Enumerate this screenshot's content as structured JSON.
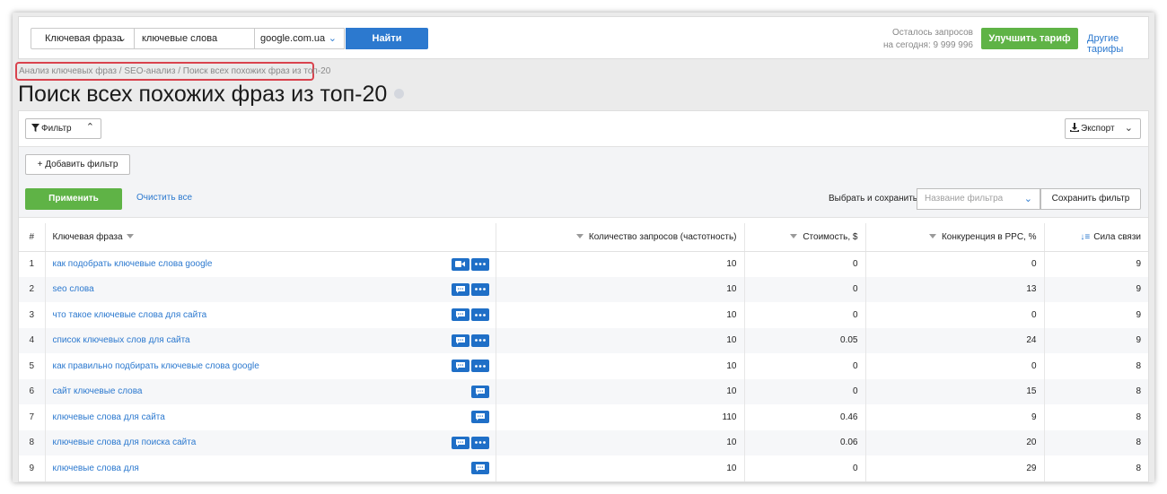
{
  "search": {
    "type_label": "Ключевая фраза",
    "keyword_value": "ключевые слова",
    "domain_value": "google.com.ua",
    "find_label": "Найти"
  },
  "quota": {
    "line1": "Осталось запросов",
    "line2": "на сегодня: 9 999 996"
  },
  "upgrade_label": "Улучшить тариф",
  "tariffs_link": "Другие тарифы",
  "breadcrumb": "Анализ ключевых фраз / SEO-анализ / Поиск всех похожих фраз из топ-20",
  "page_title": "Поиск всех похожих фраз из топ-20",
  "toolbar": {
    "filter_label": "Фильтр",
    "export_label": "Экспорт"
  },
  "filters": {
    "add_label": "+ Добавить фильтр",
    "apply_label": "Применить",
    "clear_label": "Очистить все",
    "save_label": "Выбрать и сохранить",
    "name_placeholder": "Название фильтра",
    "save_button": "Сохранить фильтр"
  },
  "table": {
    "headers": {
      "num": "#",
      "phrase": "Ключевая фраза",
      "volume": "Количество запросов (частотность)",
      "cost": "Стоимость, $",
      "competition": "Конкуренция в PPC, %",
      "strength": "Сила связи"
    },
    "rows": [
      {
        "num": "1",
        "phrase": "как подобрать ключевые слова google",
        "volume": "10",
        "cost": "0",
        "competition": "0",
        "strength": "9",
        "icons": [
          "video-icon",
          "more-icon"
        ]
      },
      {
        "num": "2",
        "phrase": "seo слова",
        "volume": "10",
        "cost": "0",
        "competition": "13",
        "strength": "9",
        "icons": [
          "comment-icon",
          "more-icon"
        ]
      },
      {
        "num": "3",
        "phrase": "что такое ключевые слова для сайта",
        "volume": "10",
        "cost": "0",
        "competition": "0",
        "strength": "9",
        "icons": [
          "comment-icon",
          "more-icon"
        ]
      },
      {
        "num": "4",
        "phrase": "список ключевых слов для сайта",
        "volume": "10",
        "cost": "0.05",
        "competition": "24",
        "strength": "9",
        "icons": [
          "comment-icon",
          "more-icon"
        ]
      },
      {
        "num": "5",
        "phrase": "как правильно подбирать ключевые слова google",
        "volume": "10",
        "cost": "0",
        "competition": "0",
        "strength": "8",
        "icons": [
          "comment-icon",
          "more-icon"
        ]
      },
      {
        "num": "6",
        "phrase": "сайт ключевые слова",
        "volume": "10",
        "cost": "0",
        "competition": "15",
        "strength": "8",
        "icons": [
          "comment-icon"
        ]
      },
      {
        "num": "7",
        "phrase": "ключевые слова для сайта",
        "volume": "110",
        "cost": "0.46",
        "competition": "9",
        "strength": "8",
        "icons": [
          "comment-icon"
        ]
      },
      {
        "num": "8",
        "phrase": "ключевые слова для поиска сайта",
        "volume": "10",
        "cost": "0.06",
        "competition": "20",
        "strength": "8",
        "icons": [
          "comment-icon",
          "more-icon"
        ]
      },
      {
        "num": "9",
        "phrase": "ключевые слова для",
        "volume": "10",
        "cost": "0",
        "competition": "29",
        "strength": "8",
        "icons": [
          "comment-icon"
        ]
      }
    ]
  },
  "colors": {
    "accent": "#2c79cf",
    "green": "#5fb346",
    "highlight_border": "#d9434e"
  }
}
